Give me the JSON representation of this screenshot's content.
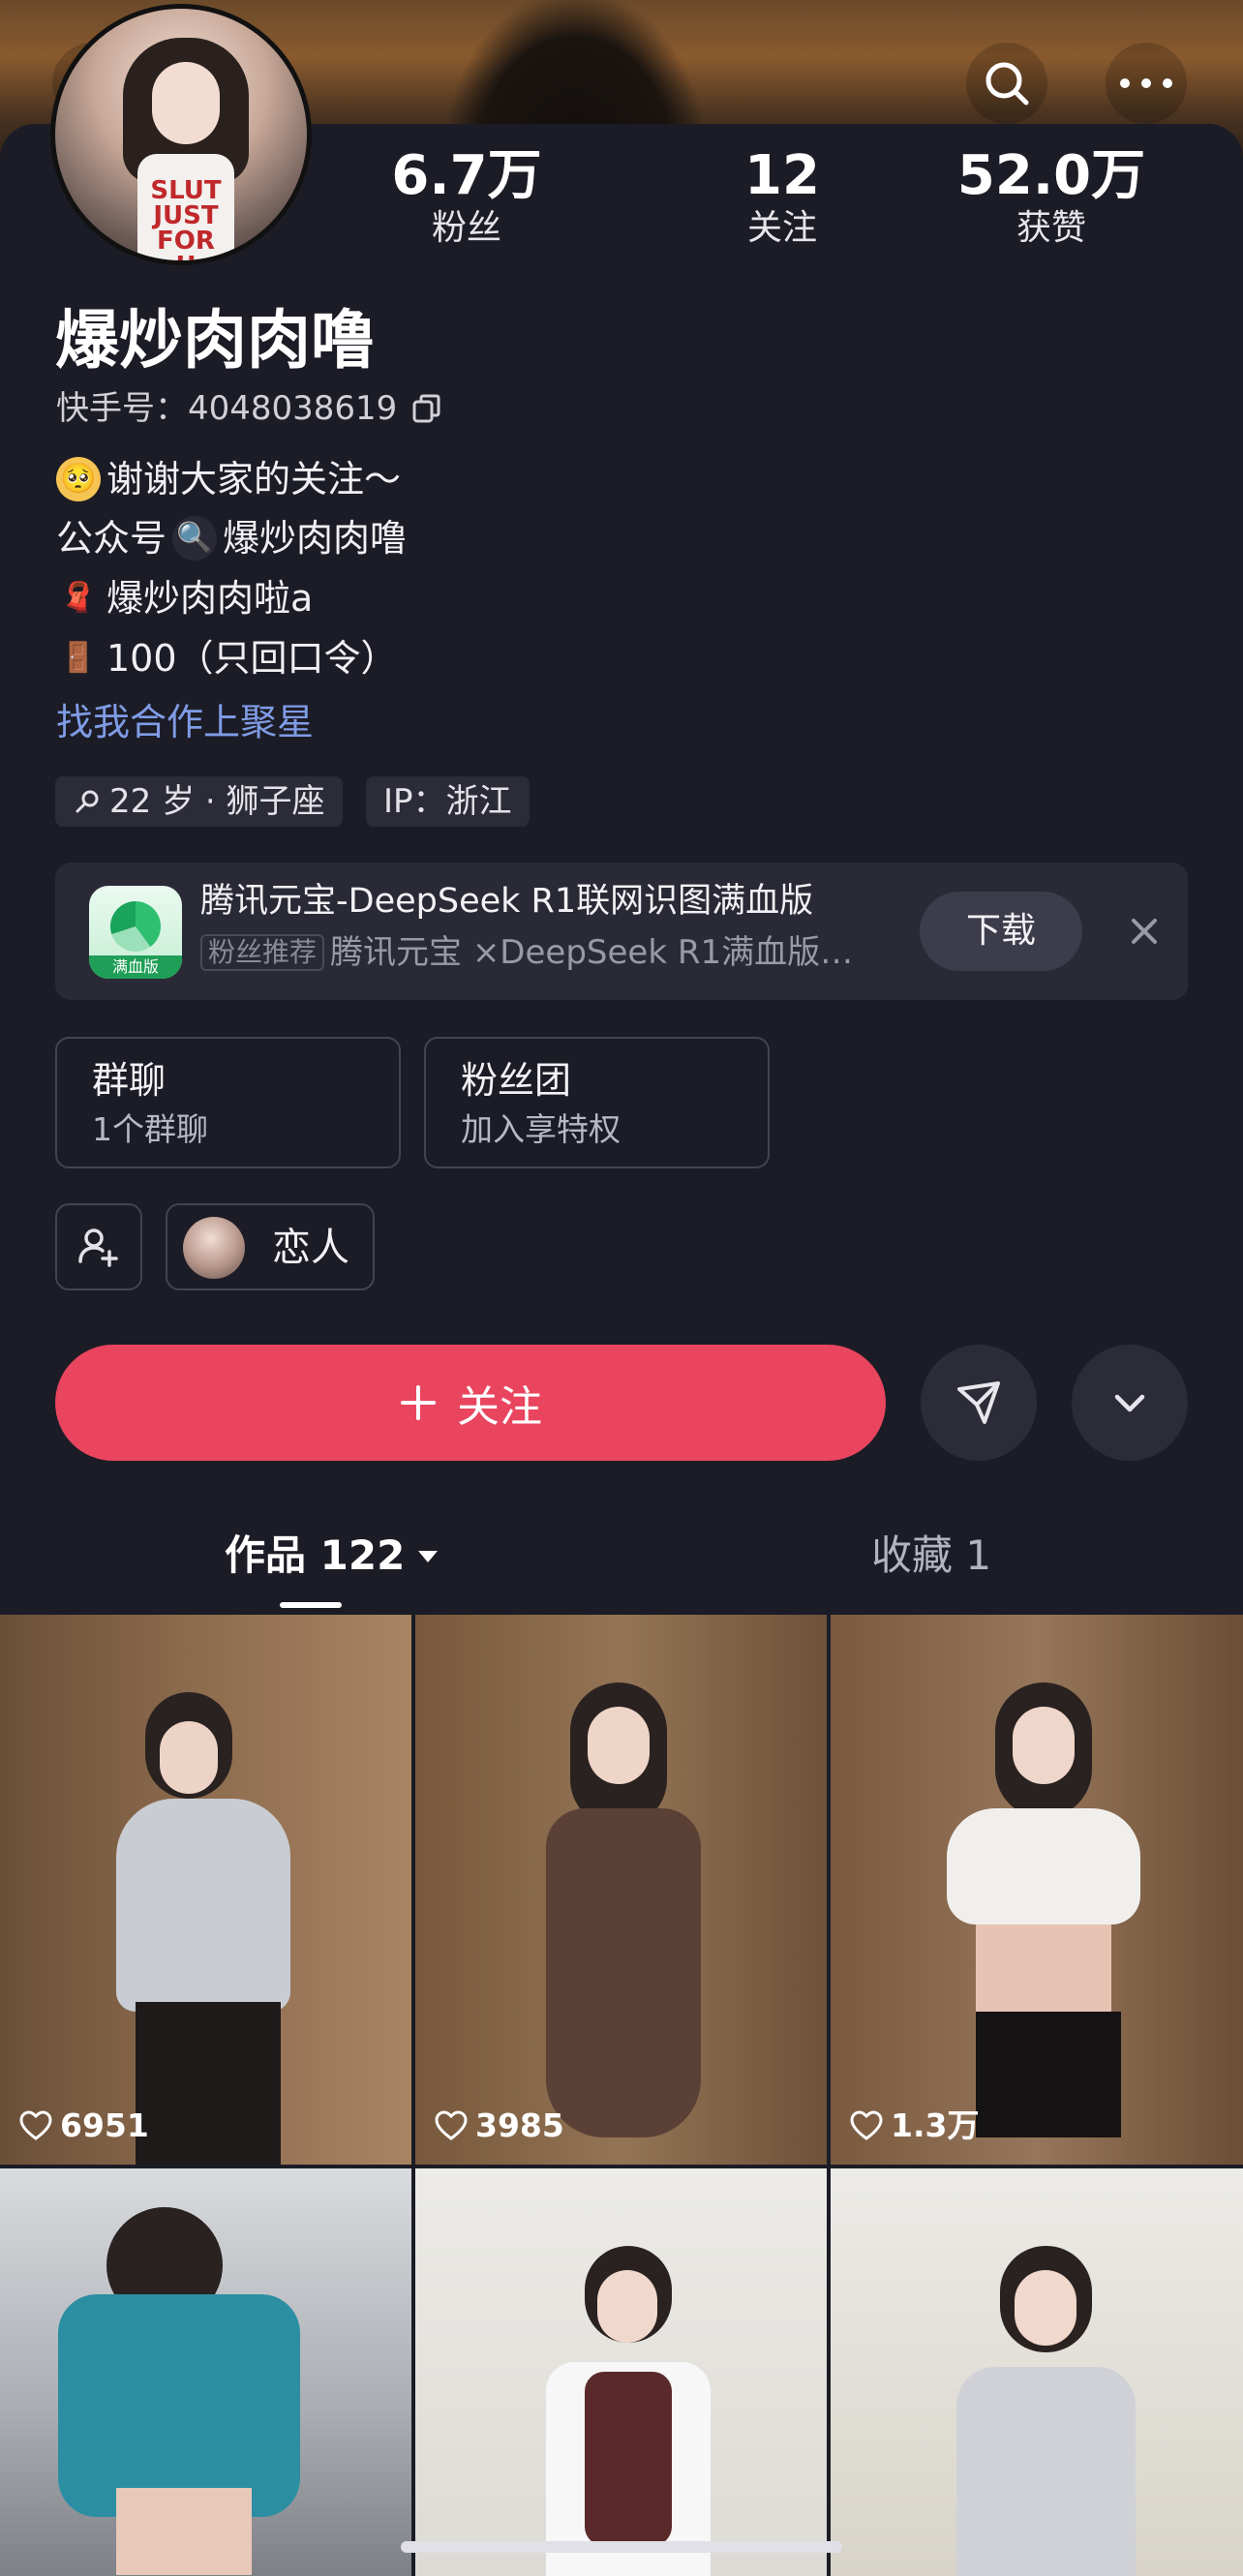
{
  "header": {
    "stats": [
      {
        "number": "6.7万",
        "label": "粉丝"
      },
      {
        "number": "12",
        "label": "关注"
      },
      {
        "number": "52.0万",
        "label": "获赞"
      }
    ],
    "avatar_text": "SLUT JUST FOR U"
  },
  "profile": {
    "name": "爆炒肉肉噜",
    "kuaishou_id": "快手号：4048038619",
    "bio": [
      {
        "emoji": "🥺",
        "text": "谢谢大家的关注～"
      },
      {
        "prefix": "公众号",
        "emoji": "🔍",
        "text": "爆炒肉肉噜"
      },
      {
        "emoji": "🧣",
        "text": "爆炒肉肉啦a"
      },
      {
        "emoji": "🚪",
        "text": "100（只回口令）"
      }
    ],
    "cooperation_link": "找我合作上聚星",
    "tags": {
      "age": "22 岁 · 狮子座",
      "ip": "IP：浙江"
    }
  },
  "ad": {
    "title": "腾讯元宝-DeepSeek R1联网识图满血版",
    "badge": "粉丝推荐",
    "subtitle": "腾讯元宝 ×DeepSeek R1满血版…",
    "logo_text": "满血版",
    "download_label": "下载"
  },
  "groups": [
    {
      "title": "群聊",
      "subtitle": "1个群聊"
    },
    {
      "title": "粉丝团",
      "subtitle": "加入享特权"
    }
  ],
  "lover_label": "恋人",
  "follow_label": "关注",
  "tabs": {
    "works": "作品 122",
    "favorites": "收藏 1"
  },
  "grid": [
    {
      "likes": "6951"
    },
    {
      "likes": "3985"
    },
    {
      "likes": "1.3万"
    },
    {
      "likes": ""
    },
    {
      "likes": ""
    },
    {
      "likes": ""
    }
  ],
  "colors": {
    "background": "#1c1c26",
    "follow_button": "#e9455f",
    "link": "#7f9ce6"
  },
  "icons": [
    "back-icon",
    "search-icon",
    "more-icon",
    "copy-icon",
    "search-small-icon",
    "close-icon",
    "add-friend-icon",
    "plus-icon",
    "share-icon",
    "chevron-down-icon",
    "caret-down-icon",
    "heart-icon"
  ]
}
